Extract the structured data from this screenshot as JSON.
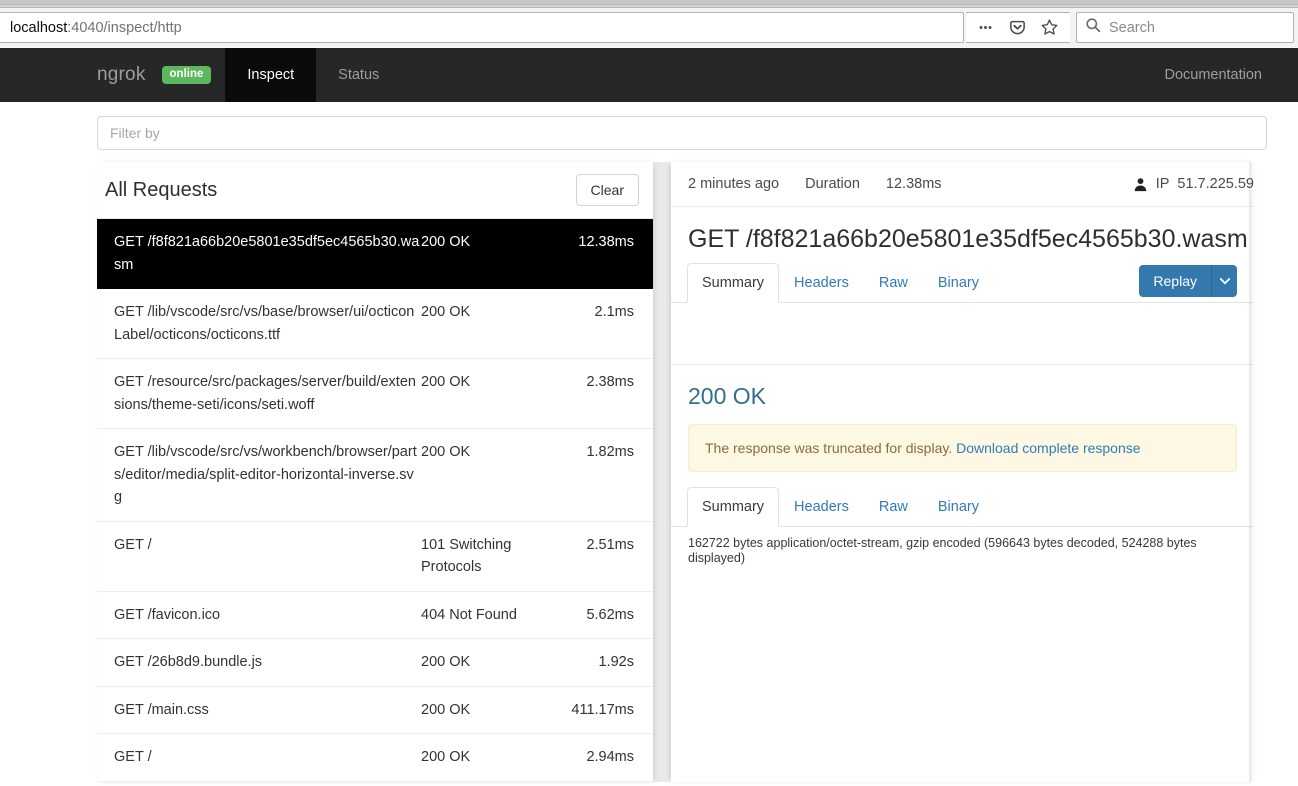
{
  "browser": {
    "url_host": "localhost",
    "url_path": ":4040/inspect/http",
    "ellipsis_icon": "page-actions-icon",
    "pocket_icon": "pocket-icon",
    "star_icon": "bookmark-star-icon",
    "search_placeholder": "Search",
    "search_icon": "search-icon"
  },
  "navbar": {
    "brand": "ngrok",
    "status_badge": "online",
    "status_color": "#5cb85c",
    "links": [
      {
        "label": "Inspect",
        "active": true
      },
      {
        "label": "Status",
        "active": false
      }
    ],
    "documentation": "Documentation"
  },
  "filter": {
    "placeholder": "Filter by",
    "value": ""
  },
  "requests_panel": {
    "title": "All Requests",
    "clear_label": "Clear",
    "rows": [
      {
        "path": "GET /f8f821a66b20e5801e35df5ec4565b30.wasm",
        "status": "200 OK",
        "time": "12.38ms",
        "selected": true
      },
      {
        "path": "GET /lib/vscode/src/vs/base/browser/ui/octiconLabel/octicons/octicons.ttf",
        "status": "200 OK",
        "time": "2.1ms",
        "selected": false
      },
      {
        "path": "GET /resource/src/packages/server/build/extensions/theme-seti/icons/seti.woff",
        "status": "200 OK",
        "time": "2.38ms",
        "selected": false
      },
      {
        "path": "GET /lib/vscode/src/vs/workbench/browser/parts/editor/media/split-editor-horizontal-inverse.svg",
        "status": "200 OK",
        "time": "1.82ms",
        "selected": false
      },
      {
        "path": "GET /",
        "status": "101 Switching Protocols",
        "time": "2.51ms",
        "selected": false
      },
      {
        "path": "GET /favicon.ico",
        "status": "404 Not Found",
        "time": "5.62ms",
        "selected": false
      },
      {
        "path": "GET /26b8d9.bundle.js",
        "status": "200 OK",
        "time": "1.92s",
        "selected": false
      },
      {
        "path": "GET /main.css",
        "status": "200 OK",
        "time": "411.17ms",
        "selected": false
      },
      {
        "path": "GET /",
        "status": "200 OK",
        "time": "2.94ms",
        "selected": false
      }
    ]
  },
  "detail_panel": {
    "timestamp": "2 minutes ago",
    "duration_label": "Duration",
    "duration_value": "12.38ms",
    "ip_label": "IP",
    "ip_value": "51.7.225.59",
    "person_icon": "person-icon",
    "request_title": "GET /f8f821a66b20e5801e35df5ec4565b30.wasm",
    "request_tabs": [
      {
        "label": "Summary",
        "active": true
      },
      {
        "label": "Headers",
        "active": false
      },
      {
        "label": "Raw",
        "active": false
      },
      {
        "label": "Binary",
        "active": false
      }
    ],
    "replay_label": "Replay",
    "replay_caret_icon": "caret-down-icon",
    "replay_color": "#3479ae",
    "response_status": "200 OK",
    "response_status_color": "#31708f",
    "alert_text": "The response was truncated for display.",
    "alert_link": "Download complete response",
    "alert_bg": "#fcf8e3",
    "response_tabs": [
      {
        "label": "Summary",
        "active": true
      },
      {
        "label": "Headers",
        "active": false
      },
      {
        "label": "Raw",
        "active": false
      },
      {
        "label": "Binary",
        "active": false
      }
    ],
    "response_body": "162722 bytes application/octet-stream, gzip encoded (596643 bytes decoded, 524288 bytes displayed)"
  }
}
